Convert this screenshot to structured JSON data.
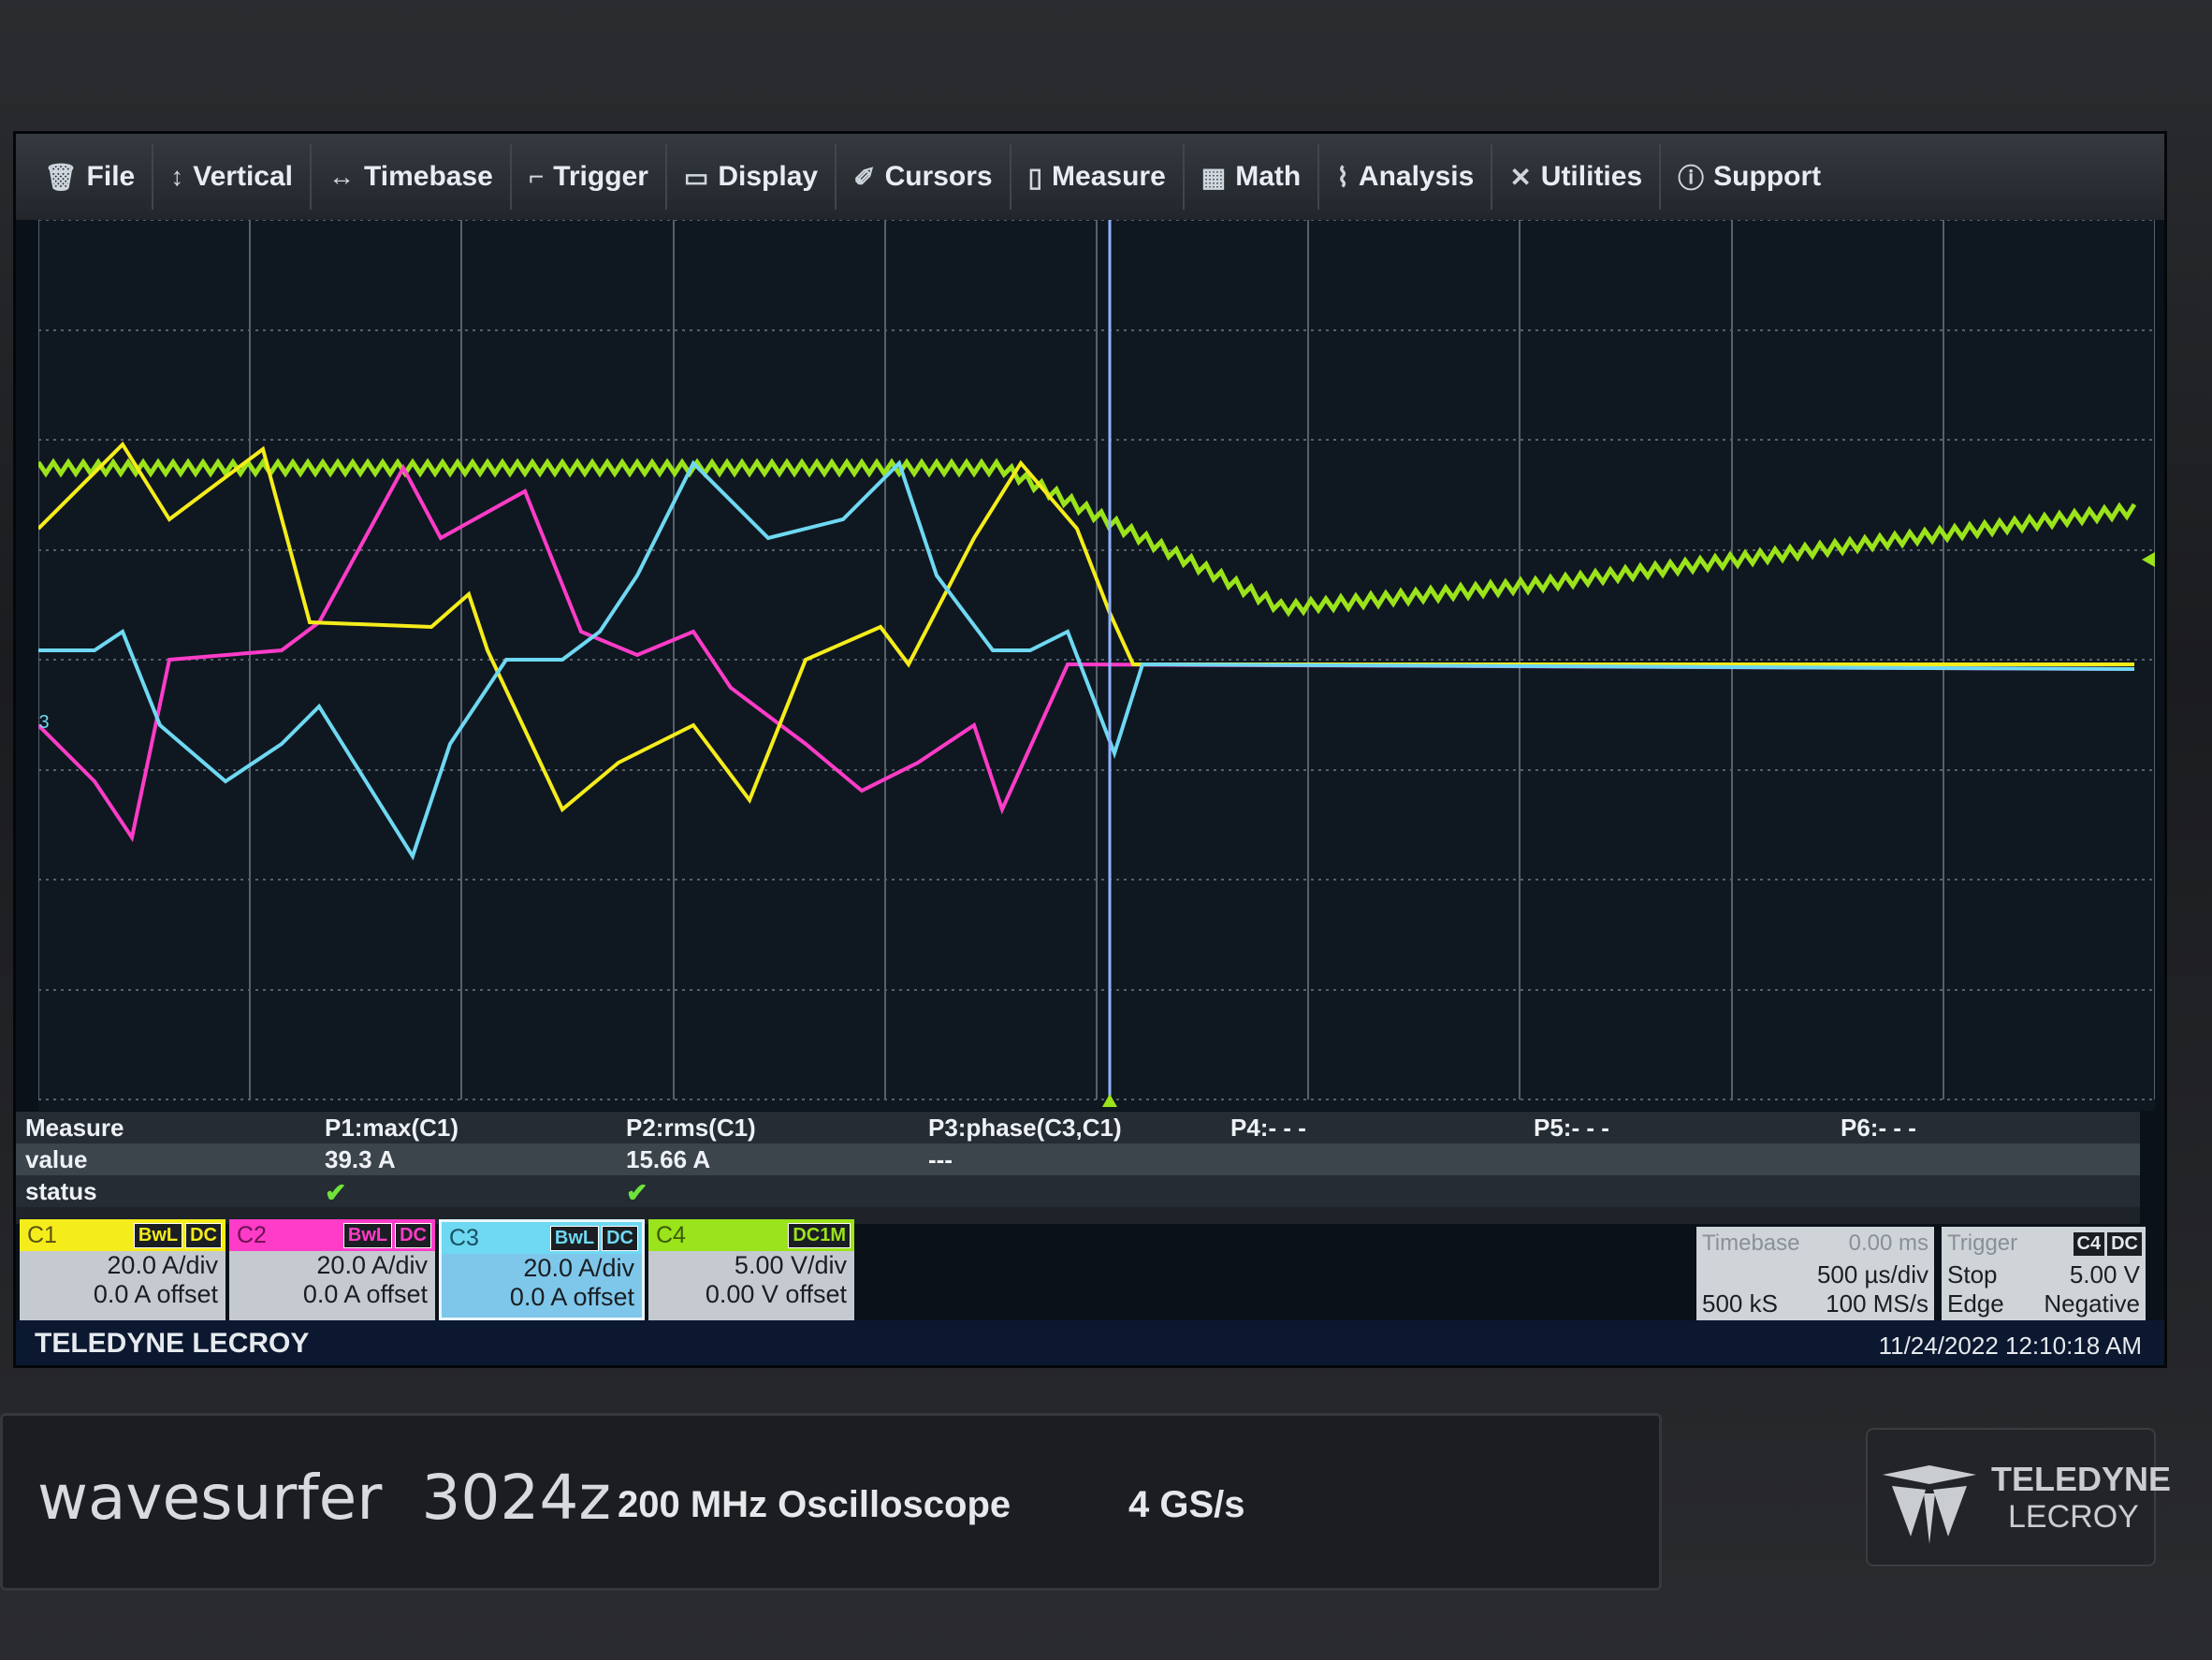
{
  "menu": [
    {
      "label": "File",
      "icon": "file-icon",
      "glyph": "🗑"
    },
    {
      "label": "Vertical",
      "icon": "vertical-icon",
      "glyph": "↕"
    },
    {
      "label": "Timebase",
      "icon": "timebase-icon",
      "glyph": "↔"
    },
    {
      "label": "Trigger",
      "icon": "trigger-icon",
      "glyph": "⌐"
    },
    {
      "label": "Display",
      "icon": "display-icon",
      "glyph": "▭"
    },
    {
      "label": "Cursors",
      "icon": "cursors-icon",
      "glyph": "✐"
    },
    {
      "label": "Measure",
      "icon": "measure-icon",
      "glyph": "▯"
    },
    {
      "label": "Math",
      "icon": "math-icon",
      "glyph": "▦"
    },
    {
      "label": "Analysis",
      "icon": "analysis-icon",
      "glyph": "⌇"
    },
    {
      "label": "Utilities",
      "icon": "utilities-icon",
      "glyph": "✕"
    },
    {
      "label": "Support",
      "icon": "support-icon",
      "glyph": "ⓘ"
    }
  ],
  "ground_marker": "C3",
  "measure": {
    "row_labels": [
      "Measure",
      "value",
      "status"
    ],
    "params": [
      {
        "name": "P1:max(C1)",
        "value": "39.3 A",
        "status": "✔"
      },
      {
        "name": "P2:rms(C1)",
        "value": "15.66 A",
        "status": "✔"
      },
      {
        "name": "P3:phase(C3,C1)",
        "value": "---",
        "status": ""
      },
      {
        "name": "P4:- - -",
        "value": "",
        "status": ""
      },
      {
        "name": "P5:- - -",
        "value": "",
        "status": ""
      },
      {
        "name": "P6:- - -",
        "value": "",
        "status": ""
      }
    ]
  },
  "channels": [
    {
      "id": "C1",
      "tags": [
        "BwL",
        "DC"
      ],
      "scale": "20.0 A/div",
      "offset": "0.0 A offset",
      "color": "#f5ec1b"
    },
    {
      "id": "C2",
      "tags": [
        "BwL",
        "DC"
      ],
      "scale": "20.0 A/div",
      "offset": "0.0 A offset",
      "color": "#ff3cc8"
    },
    {
      "id": "C3",
      "tags": [
        "BwL",
        "DC"
      ],
      "scale": "20.0 A/div",
      "offset": "0.0 A offset",
      "color": "#6fd8f2"
    },
    {
      "id": "C4",
      "tags": [
        "DC1M"
      ],
      "scale": "5.00 V/div",
      "offset": "0.00 V offset",
      "color": "#9be31a"
    }
  ],
  "timebase": {
    "label": "Timebase",
    "delay": "0.00 ms",
    "rate": "500 µs/div",
    "samples": "500 kS",
    "srate": "100 MS/s"
  },
  "trigger": {
    "label": "Trigger",
    "tags": [
      "C4",
      "DC"
    ],
    "mode": "Stop",
    "level": "5.00 V",
    "type": "Edge",
    "slope": "Negative"
  },
  "brand": "TELEDYNE LECROY",
  "timestamp": "11/24/2022 12:10:18 AM",
  "front_panel": {
    "model_name": "wavesurfer",
    "model_number": "3024z",
    "bandwidth": "200 MHz Oscilloscope",
    "sample_rate": "4 GS/s",
    "logo_line1": "TELEDYNE",
    "logo_line2": "LECROY"
  }
}
